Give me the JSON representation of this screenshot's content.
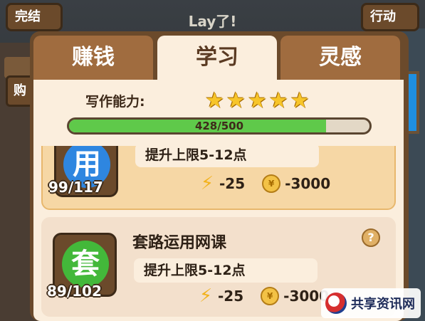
{
  "header": {
    "title": "Lay了!",
    "left_button": "完结",
    "right_button": "行动",
    "side_button": "购"
  },
  "tabs": [
    {
      "label": "赚钱",
      "active": false
    },
    {
      "label": "学习",
      "active": true
    },
    {
      "label": "灵感",
      "active": false
    }
  ],
  "skill": {
    "label": "写作能力:",
    "stars": 5,
    "progress_text": "428/500",
    "progress_value": 428,
    "progress_max": 500
  },
  "items": [
    {
      "icon_char": "用",
      "icon_color": "#2e86e0",
      "count": "99/117",
      "desc": "提升上限5-12点",
      "energy_cost": "-25",
      "coin_cost": "-3000"
    },
    {
      "icon_char": "套",
      "icon_color": "#43b83a",
      "count": "89/102",
      "name": "套路运用网课",
      "desc": "提升上限5-12点",
      "energy_cost": "-25",
      "coin_cost": "-3000"
    }
  ],
  "watermark": {
    "text": "共享资讯网"
  }
}
